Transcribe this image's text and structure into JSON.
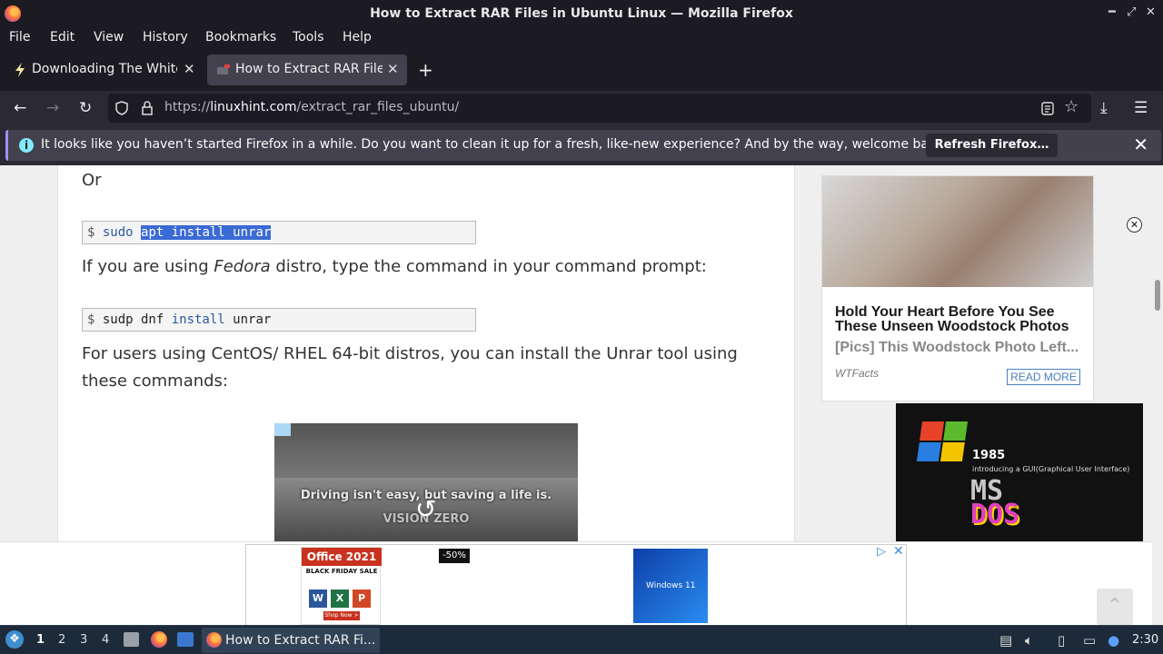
{
  "window": {
    "title": "How to Extract RAR Files in Ubuntu Linux — Mozilla Firefox"
  },
  "menu": [
    "File",
    "Edit",
    "View",
    "History",
    "Bookmarks",
    "Tools",
    "Help"
  ],
  "tabs": [
    {
      "title": "Downloading The White I",
      "active": false
    },
    {
      "title": "How to Extract RAR Files",
      "active": true
    }
  ],
  "nav": {
    "url_prefix": "https://",
    "url_domain": "linuxhint.com",
    "url_path": "/extract_rar_files_ubuntu/"
  },
  "notification": {
    "message": "It looks like you haven’t started Firefox in a while. Do you want to clean it up for a fresh, like-new experience? And by the way, welcome back!",
    "button": "Refresh Firefox…"
  },
  "article": {
    "or": "Or",
    "cmd1": {
      "dollar": "$ ",
      "plain": "sudo ",
      "selected": "apt install unrar"
    },
    "p_fedora_before": "If you are using ",
    "p_fedora_em": "Fedora",
    "p_fedora_after": " distro, type the command in your command prompt:",
    "cmd2": {
      "dollar": "$ ",
      "part1": "sudp dnf ",
      "kw": "install",
      "part2": " unrar"
    },
    "p_centos_line1": "For users using CentOS/ RHEL 64-bit distros, you can install the Unrar tool using",
    "p_centos_line2": "these commands:",
    "video_caption": "Driving isn't easy, but saving a life is.",
    "video_brand": "VISION ZERO"
  },
  "side_ad": {
    "headline": "Hold Your Heart Before You See These Unseen Woodstock Photos",
    "sub": "[Pics] This Woodstock Photo Left...",
    "source": "WTFacts",
    "cta": "READ MORE"
  },
  "msdos_ad": {
    "year": "1985",
    "intro": "introducing a GUI(Graphical User Interface)",
    "ms": "MS",
    "dos": "DOS"
  },
  "bottom_ad": {
    "office_title": "Office 2021",
    "black_friday": "BLACK FRIDAY SALE",
    "shop": "Shop Now >",
    "discount": "-50%",
    "windows": "Windows 11"
  },
  "taskbar": {
    "workspaces": [
      "1",
      "2",
      "3",
      "4"
    ],
    "task": "How to Extract RAR Fi...",
    "clock": "2:30"
  },
  "colors": {
    "accent": "#a78bfa",
    "link": "#3a6ad4"
  }
}
